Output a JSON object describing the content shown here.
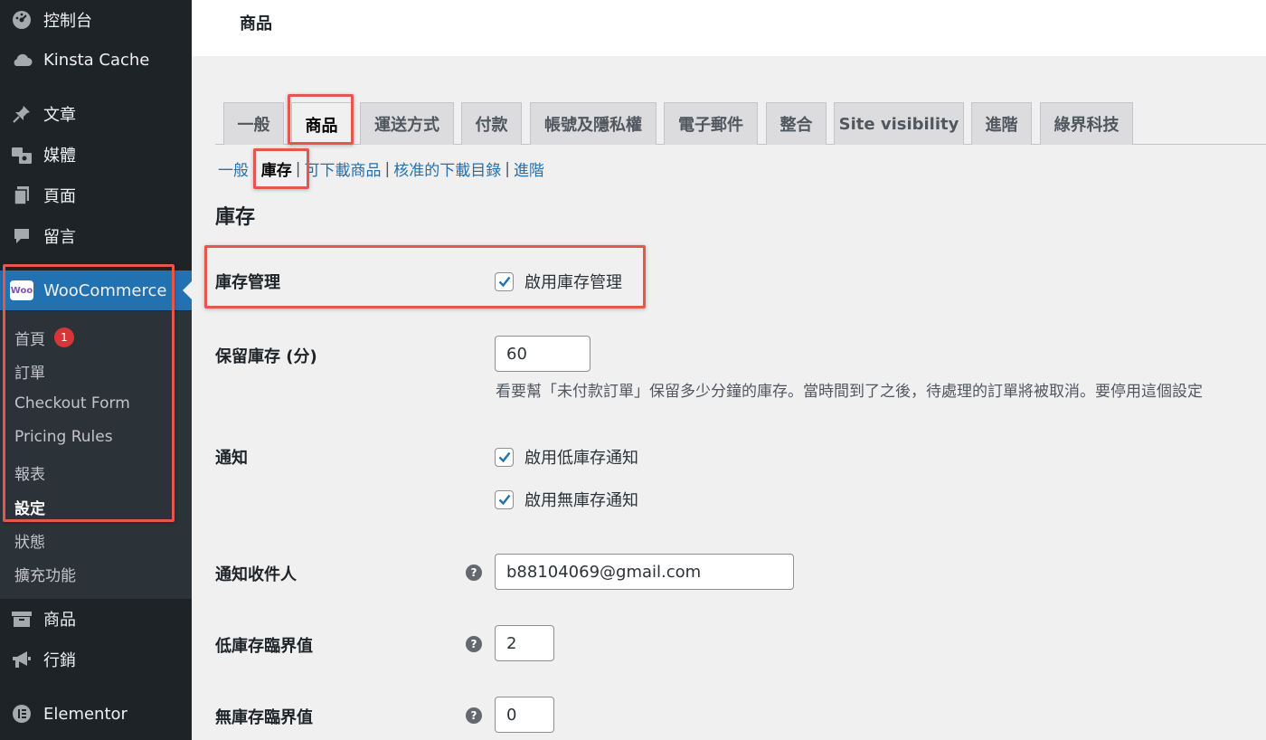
{
  "sidebar": {
    "menu": {
      "dashboard": {
        "label": "控制台",
        "icon": "dashboard-gauge-icon"
      },
      "kinsta": {
        "label": "Kinsta Cache",
        "icon": "cloud-icon"
      },
      "posts": {
        "label": "文章",
        "icon": "pushpin-icon"
      },
      "media": {
        "label": "媒體",
        "icon": "media-icon"
      },
      "pages": {
        "label": "頁面",
        "icon": "pages-icon"
      },
      "comments": {
        "label": "留言",
        "icon": "comment-bubble-icon"
      },
      "woocommerce": {
        "label": "WooCommerce",
        "icon": "woo-logo-icon",
        "logo_text": "Woo"
      },
      "products": {
        "label": "商品",
        "icon": "archive-box-icon"
      },
      "marketing": {
        "label": "行銷",
        "icon": "megaphone-icon"
      },
      "elementor": {
        "label": "Elementor",
        "icon": "elementor-icon"
      }
    },
    "submenu": {
      "home": "首頁",
      "home_badge": "1",
      "orders": "訂單",
      "checkout_form": "Checkout Form",
      "pricing_rules": "Pricing Rules",
      "reports": "報表",
      "settings": "設定",
      "status": "狀態",
      "extensions": "擴充功能"
    }
  },
  "header": {
    "title": "商品"
  },
  "tabs": [
    "一般",
    "商品",
    "運送方式",
    "付款",
    "帳號及隱私權",
    "電子郵件",
    "整合",
    "Site visibility",
    "進階",
    "綠界科技"
  ],
  "active_tab": "商品",
  "subnav": {
    "items": [
      "一般",
      "庫存",
      "可下載商品",
      "核准的下載目錄",
      "進階"
    ],
    "separator": "|",
    "current": "庫存"
  },
  "section": {
    "title": "庫存"
  },
  "fields": {
    "manage_stock": {
      "label": "庫存管理",
      "checkbox_label": "啟用庫存管理",
      "checked": true
    },
    "hold_stock": {
      "label": "保留庫存 (分)",
      "value": "60",
      "description": "看要幫「未付款訂單」保留多少分鐘的庫存。當時間到了之後，待處理的訂單將被取消。要停用這個設定"
    },
    "notifications": {
      "label": "通知",
      "low_stock_label": "啟用低庫存通知",
      "low_stock_checked": true,
      "no_stock_label": "啟用無庫存通知",
      "no_stock_checked": true
    },
    "recipient": {
      "label": "通知收件人",
      "value": "b88104069@gmail.com",
      "help": "?"
    },
    "low_threshold": {
      "label": "低庫存臨界值",
      "value": "2",
      "help": "?"
    },
    "no_threshold": {
      "label": "無庫存臨界值",
      "value": "0",
      "help": "?"
    }
  },
  "colors": {
    "sidebar_bg": "#1d2327",
    "submenu_bg": "#2c3338",
    "active_menu": "#2271b1",
    "link": "#2271b1",
    "highlight": "#e4574d",
    "badge": "#d63638"
  }
}
